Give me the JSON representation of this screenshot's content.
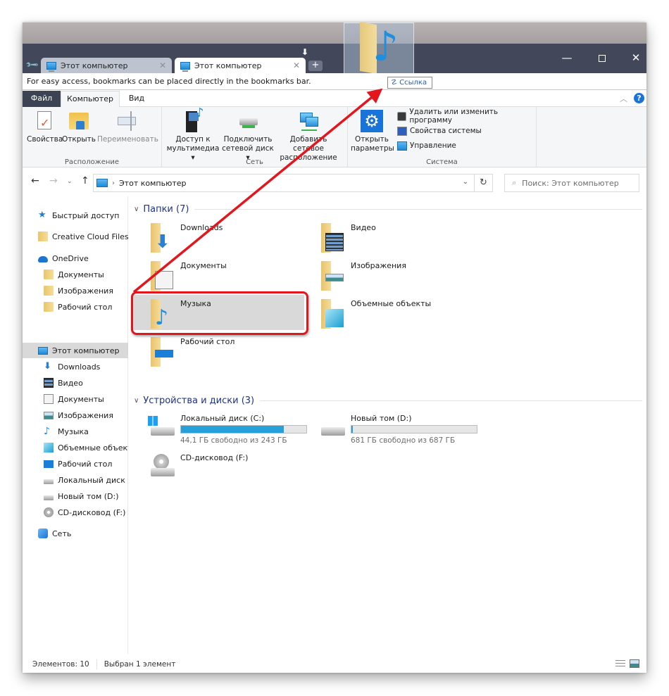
{
  "browser": {
    "tabs": [
      {
        "label": "Этот компьютер",
        "active": false
      },
      {
        "label": "Этот компьютер",
        "active": true
      }
    ],
    "new_tab_symbol": "+",
    "bookmarks_hint": "For easy access, bookmarks can be placed directly in the bookmarks bar.",
    "drop_badge": "Ссылка",
    "window_controls": {
      "minimize": "—",
      "maximize": "",
      "close": "✕"
    }
  },
  "ribbon": {
    "tabs": [
      "Файл",
      "Компьютер",
      "Вид"
    ],
    "active_tab": "Компьютер",
    "groups": [
      {
        "label": "Расположение",
        "buttons": [
          {
            "label": "Свойства",
            "enabled": true
          },
          {
            "label": "Открыть",
            "enabled": true
          },
          {
            "label": "Переименовать",
            "enabled": false
          }
        ]
      },
      {
        "label": "Сеть",
        "buttons": [
          {
            "label_line1": "Доступ к",
            "label_line2": "мультимедиа ▾"
          },
          {
            "label_line1": "Подключить",
            "label_line2": "сетевой диск ▾"
          },
          {
            "label_line1": "Добавить сетевое",
            "label_line2": "расположение"
          }
        ]
      },
      {
        "label": "Система",
        "big_button": {
          "label_line1": "Открыть",
          "label_line2": "параметры"
        },
        "small_buttons": [
          "Удалить или изменить программу",
          "Свойства системы",
          "Управление"
        ]
      }
    ]
  },
  "address_bar": {
    "path": "Этот компьютер",
    "search_placeholder": "Поиск: Этот компьютер"
  },
  "sidebar": {
    "items": [
      {
        "label": "Быстрый доступ",
        "icon": "star-icon",
        "level": 0
      },
      {
        "label": "Creative Cloud Files",
        "icon": "creative-cloud-folder-icon",
        "level": 0
      },
      {
        "label": "OneDrive",
        "icon": "cloud-icon",
        "level": 0
      },
      {
        "label": "Документы",
        "icon": "folder-icon",
        "level": 1
      },
      {
        "label": "Изображения",
        "icon": "folder-icon",
        "level": 1
      },
      {
        "label": "Рабочий стол",
        "icon": "folder-icon",
        "level": 1
      },
      {
        "label": "Этот компьютер",
        "icon": "computer-icon",
        "level": 0,
        "selected": true
      },
      {
        "label": "Downloads",
        "icon": "download-icon",
        "level": 1
      },
      {
        "label": "Видео",
        "icon": "video-icon",
        "level": 1
      },
      {
        "label": "Документы",
        "icon": "document-icon",
        "level": 1
      },
      {
        "label": "Изображения",
        "icon": "image-icon",
        "level": 1
      },
      {
        "label": "Музыка",
        "icon": "music-icon",
        "level": 1
      },
      {
        "label": "Объемные объект",
        "icon": "3d-objects-icon",
        "level": 1
      },
      {
        "label": "Рабочий стол",
        "icon": "desktop-icon",
        "level": 1
      },
      {
        "label": "Локальный диск (С",
        "icon": "system-drive-icon",
        "level": 1
      },
      {
        "label": "Новый том (D:)",
        "icon": "drive-icon",
        "level": 1
      },
      {
        "label": "CD-дисковод (F:)",
        "icon": "cd-drive-icon",
        "level": 1
      },
      {
        "label": "Сеть",
        "icon": "network-icon",
        "level": 0
      }
    ]
  },
  "content": {
    "folders_header": "Папки (7)",
    "folders": [
      {
        "name": "Downloads",
        "overlay": "download"
      },
      {
        "name": "Видео",
        "overlay": "video"
      },
      {
        "name": "Документы",
        "overlay": "document"
      },
      {
        "name": "Изображения",
        "overlay": "image"
      },
      {
        "name": "Музыка",
        "overlay": "music",
        "selected": true
      },
      {
        "name": "Объемные объекты",
        "overlay": "3d"
      },
      {
        "name": "Рабочий стол",
        "overlay": "desktop"
      }
    ],
    "devices_header": "Устройства и диски (3)",
    "devices": [
      {
        "name": "Локальный диск (C:)",
        "free_text": "44,1 ГБ свободно из 243 ГБ",
        "used_fraction": 0.82
      },
      {
        "name": "Новый том (D:)",
        "free_text": "681 ГБ свободно из 687 ГБ",
        "used_fraction": 0.01
      },
      {
        "name": "CD-дисковод (F:)"
      }
    ]
  },
  "status_bar": {
    "items_count": "Элементов: 10",
    "selected": "Выбран 1 элемент"
  },
  "annotation": {
    "color": "#e3161d"
  },
  "colors": {
    "titlebar": "#424859",
    "accent": "#1e3287",
    "drive_fill": "#26a0da"
  }
}
